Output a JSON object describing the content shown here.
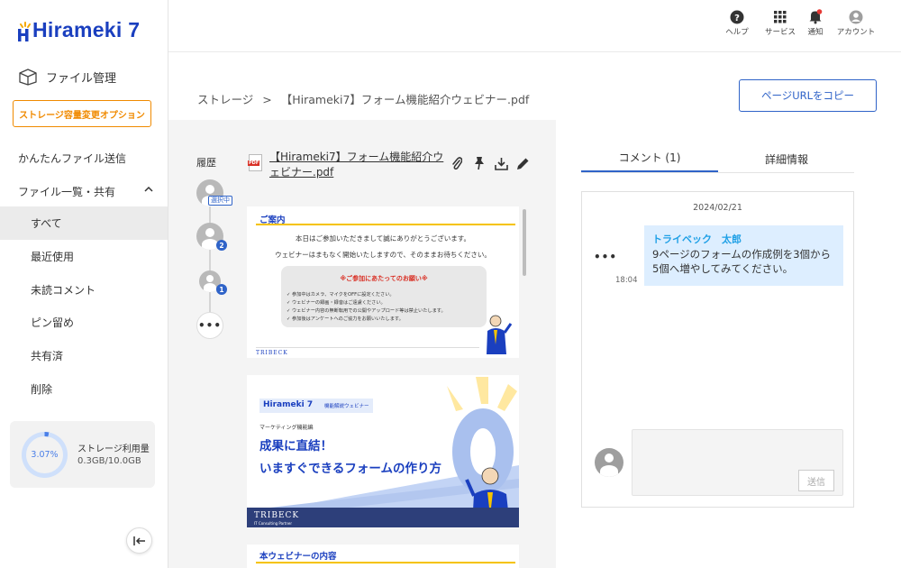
{
  "brand": {
    "name": "Hirameki 7"
  },
  "sidebar": {
    "section_title": "ファイル管理",
    "option_button": "ストレージ容量変更オプション",
    "easy_send": "かんたんファイル送信",
    "file_share": "ファイル一覧・共有",
    "items": [
      {
        "label": "すべて",
        "active": true
      },
      {
        "label": "最近使用"
      },
      {
        "label": "未読コメント"
      },
      {
        "label": "ピン留め"
      },
      {
        "label": "共有済"
      },
      {
        "label": "削除"
      }
    ],
    "storage": {
      "percent": "3.07%",
      "label": "ストレージ利用量",
      "usage": "0.3GB/10.0GB",
      "ratio": 0.0307
    }
  },
  "header": {
    "help": "ヘルプ",
    "services": "サービス",
    "notifications": "通知",
    "account": "アカウント"
  },
  "breadcrumb": {
    "root": "ストレージ",
    "separator": ">",
    "current": "【Hirameki7】フォーム機能紹介ウェビナー.pdf"
  },
  "copy_url_button": "ページURLをコピー",
  "viewer": {
    "history_label": "履歴",
    "selected_tag": "選択中",
    "badges": [
      "2",
      "1"
    ],
    "file_title": "【Hirameki7】フォーム機能紹介ウェビナー.pdf",
    "file_badge": "PDF",
    "page1": {
      "heading": "ご案内",
      "line1": "本日はご参加いただきまして誠にありがとうございます。",
      "line2": "ウェビナーはまもなく開始いたしますので、そのままお待ちください。",
      "notice_title": "※ご参加にあたってのお願い※",
      "notices": [
        "✓ 参加中はカメラ、マイクをOFFに設定ください。",
        "✓ ウェビナーの録画・録音はご遠慮ください。",
        "✓ ウェビナー内容の無断転用での公開やアップロード等は禁止いたします。",
        "✓ 参加後はアンケートへのご協力をお願いいたします。"
      ],
      "footer_brand": "TRIBECK"
    },
    "page2": {
      "brand_tag": "Hirameki 7",
      "series": "機能解説ウェビナー",
      "category": "マーケティング機能編",
      "title1": "成果に直結！",
      "title2": "いますぐできるフォームの作り方",
      "footer_brand": "TRIBECK",
      "footer_sub": "IT Consulting Partner"
    },
    "page3": {
      "heading": "本ウェビナーの内容"
    }
  },
  "comments_panel": {
    "tabs": [
      {
        "label": "コメント (1)",
        "active": true
      },
      {
        "label": "詳細情報"
      }
    ],
    "date": "2024/02/21",
    "comment": {
      "author": "トライベック　太郎",
      "text": "9ページのフォームの作成例を3個から5個へ増やしてみてください。",
      "time": "18:04"
    },
    "more": "•••",
    "send_button": "送信"
  },
  "colors": {
    "brand": "#1a3fbf",
    "accent": "#2f63c8",
    "orange": "#f08a00",
    "bubble": "#ddeeff"
  }
}
